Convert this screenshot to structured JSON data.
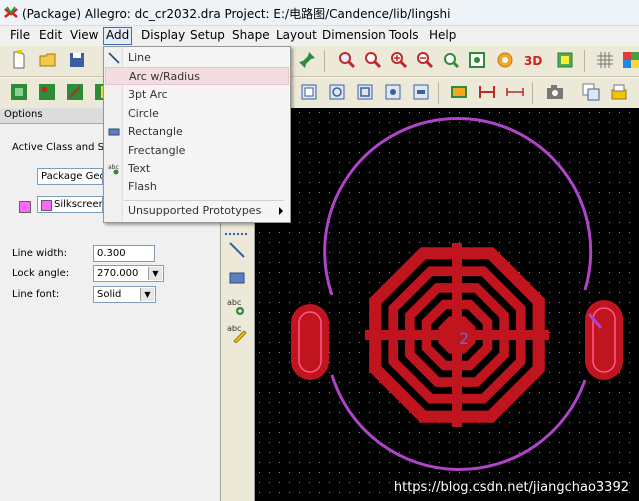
{
  "window": {
    "title": "(Package) Allegro: dc_cr2032.dra  Project: E:/电路图/Candence/lib/lingshi"
  },
  "menubar": [
    {
      "label": "File",
      "key": "file"
    },
    {
      "label": "Edit",
      "key": "edit"
    },
    {
      "label": "View",
      "key": "view"
    },
    {
      "label": "Add",
      "key": "add"
    },
    {
      "label": "Display",
      "key": "display"
    },
    {
      "label": "Setup",
      "key": "setup"
    },
    {
      "label": "Shape",
      "key": "shape"
    },
    {
      "label": "Layout",
      "key": "layout"
    },
    {
      "label": "Dimension",
      "key": "dimension"
    },
    {
      "label": "Tools",
      "key": "tools"
    },
    {
      "label": "Help",
      "key": "help"
    }
  ],
  "add_menu": {
    "items": [
      {
        "label": "Line",
        "icon": "line-icon"
      },
      {
        "label": "Arc w/Radius",
        "icon": ""
      },
      {
        "label": "3pt Arc",
        "icon": ""
      },
      {
        "label": "Circle",
        "icon": ""
      },
      {
        "label": "Rectangle",
        "icon": "rectangle-icon"
      },
      {
        "label": "Frectangle",
        "icon": ""
      },
      {
        "label": "Text",
        "icon": "text-icon"
      },
      {
        "label": "Flash",
        "icon": ""
      }
    ],
    "submenu_item": "Unsupported Prototypes",
    "highlighted_index": 1
  },
  "options_panel": {
    "tab_label": "Options",
    "active_class_label": "Active Class and Sub",
    "class_value": "Package Geom",
    "subclass_value": "Silkscreen_",
    "line_width_label": "Line width:",
    "line_width_value": "0.300",
    "lock_angle_label": "Lock angle:",
    "lock_angle_value": "270.000",
    "line_font_label": "Line font:",
    "line_font_value": "Solid",
    "subclass_color": "#ff66ff"
  },
  "canvas": {
    "pad_label": "2",
    "watermark": "https://blog.csdn.net/jiangchao3392",
    "pad_color": "#c0141e",
    "silk_color": "#b044c8"
  }
}
